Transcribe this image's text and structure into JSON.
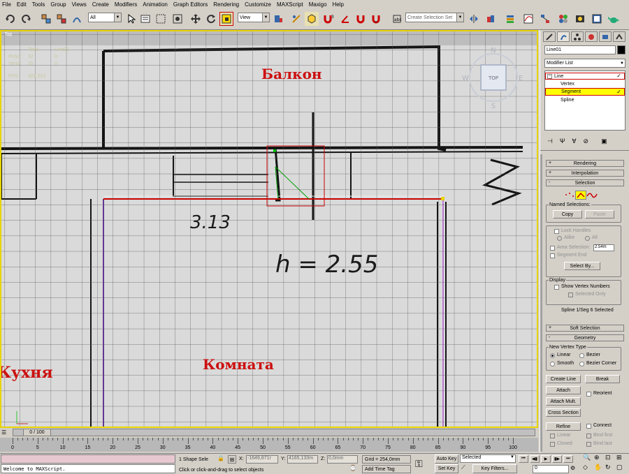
{
  "menu": [
    "File",
    "Edit",
    "Tools",
    "Group",
    "Views",
    "Create",
    "Modifiers",
    "Animation",
    "Graph Editors",
    "Rendering",
    "Customize",
    "MAXScript",
    "Maxigo",
    "Help"
  ],
  "toolbar": {
    "filter_value": "All",
    "refcoord_value": "View",
    "named_selection_placeholder": "Create Selection Set"
  },
  "viewport": {
    "label": "Top",
    "stats": {
      "col_total": "Total",
      "col_obj": "Line01",
      "polys_label": "Polys:",
      "polys_total": "32",
      "polys_obj": "0",
      "verts_label": "Verts:",
      "verts_total": "25",
      "verts_obj": "0",
      "fps_label": "FPS:",
      "fps_value": "309.223"
    },
    "plan_texts": {
      "balcony": "Балкон",
      "kitchen": "Кухня",
      "room": "Комната",
      "dim1": "3.13",
      "dim2": "h = 2.55"
    },
    "viewcube": {
      "n": "N",
      "s": "S",
      "e": "E",
      "w": "W",
      "face": "TOP"
    },
    "axis_x": "x",
    "axis_y": "y"
  },
  "right_panel": {
    "object_name": "Line01",
    "modifier_list": "Modifier List",
    "stack": [
      {
        "label": "Line",
        "level": 0,
        "selected": false
      },
      {
        "label": "Vertex",
        "level": 1,
        "selected": false
      },
      {
        "label": "Segment",
        "level": 1,
        "selected": true
      },
      {
        "label": "Spline",
        "level": 1,
        "selected": false
      }
    ],
    "rollouts": {
      "rendering": "Rendering",
      "interpolation": "Interpolation",
      "selection": "Selection",
      "soft_selection": "Soft Selection",
      "geometry": "Geometry"
    },
    "selection": {
      "named_selections": "Named Selections:",
      "copy": "Copy",
      "paste": "Paste",
      "lock_handles": "Lock Handles",
      "alike": "Alike",
      "all": "All",
      "area_selection": "Area Selection:",
      "area_value": "2.54m",
      "segment_end": "Segment End",
      "select_by": "Select By...",
      "display": "Display",
      "show_vertex_numbers": "Show Vertex Numbers",
      "selected_only": "Selected Only",
      "status": "Spline 1/Seg 6 Selected"
    },
    "geometry": {
      "new_vertex_type": "New Vertex Type",
      "linear": "Linear",
      "bezier": "Bezier",
      "smooth": "Smooth",
      "bezier_corner": "Bezier Corner",
      "create_line": "Create Line",
      "break": "Break",
      "attach": "Attach",
      "reorient": "Reorient",
      "attach_mult": "Attach Mult.",
      "cross_section": "Cross Section",
      "refine": "Refine",
      "connect": "Connect",
      "linear2": "Linear",
      "bind_first": "Bind first",
      "closed": "Closed",
      "bind_last": "Bind last"
    }
  },
  "timeline": {
    "slider_label": "0 / 100",
    "ticks": [
      "0",
      "5",
      "10",
      "15",
      "20",
      "25",
      "30",
      "35",
      "40",
      "45",
      "50",
      "55",
      "60",
      "65",
      "70",
      "75",
      "80",
      "85",
      "90",
      "95",
      "100"
    ]
  },
  "statusbar": {
    "maxscript": "Welcome to MAXScript.",
    "shape_sel": "1 Shape Sele",
    "x_label": "X:",
    "x_value": "-1649,871r",
    "y_label": "Y:",
    "y_value": "4165,133m",
    "z_label": "Z:",
    "z_value": "0,0mm",
    "grid": "Grid = 254,0mm",
    "hint": "Click or click-and-drag to select objects",
    "add_time_tag": "Add Time Tag",
    "auto_key": "Auto Key",
    "set_key": "Set Key",
    "key_mode_value": "Selected",
    "key_filters": "Key Filters...",
    "frame_value": "0"
  },
  "colors": {
    "viewport_border": "#e8d400",
    "selection_red": "#cc0000",
    "highlight_yellow": "#ffff00",
    "plan_text": "#cc1010"
  }
}
